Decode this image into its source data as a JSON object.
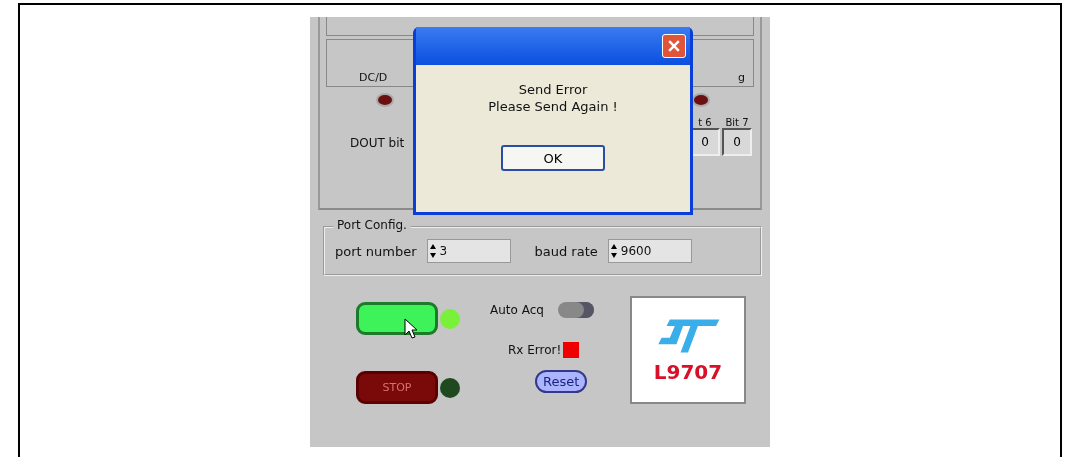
{
  "top_panel": {
    "cell_labels": [
      "DC/D",
      "g"
    ],
    "leds": [
      {
        "on": false
      },
      {
        "on": false
      }
    ],
    "dout_label": "DOUT bit",
    "bit_headers": [
      "t 6",
      "Bit 7"
    ],
    "bits": [
      "0",
      "0"
    ]
  },
  "port_config": {
    "title": "Port Config.",
    "port_label": "port number",
    "port_value": "3",
    "baud_label": "baud rate",
    "baud_value": "9600"
  },
  "controls": {
    "run_led_on": true,
    "stop_label": "STOP",
    "stop_led_on": false,
    "auto_acq_label": "Auto Acq",
    "auto_acq_on": false,
    "rx_error_label": "Rx  Error!",
    "rx_error_on": true,
    "reset_label": "Reset",
    "logo_text": "L9707"
  },
  "dialog": {
    "lines": [
      "Send Error",
      "Please Send Again !"
    ],
    "button": "OK"
  }
}
